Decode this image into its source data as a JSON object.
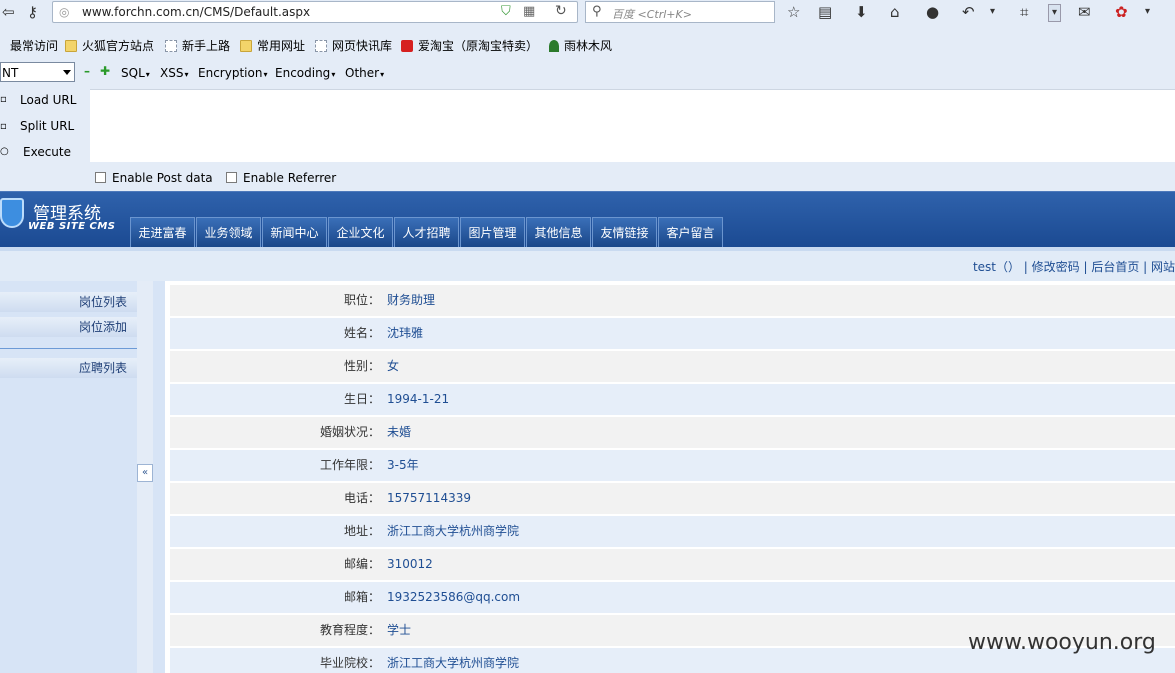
{
  "browser": {
    "url": "www.forchn.com.cn/CMS/Default.aspx",
    "search_placeholder": "百度 <Ctrl+K>"
  },
  "bookmarks": [
    "最常访问",
    "火狐官方站点",
    "新手上路",
    "常用网址",
    "网页快讯库",
    "爱淘宝（原淘宝特卖）",
    "雨林木风"
  ],
  "hackbar": {
    "select_value": "NT",
    "menus": [
      "SQL",
      "XSS",
      "Encryption",
      "Encoding",
      "Other"
    ],
    "side_actions": [
      "Load URL",
      "Split URL",
      "Execute"
    ],
    "checkboxes": [
      "Enable Post data",
      "Enable Referrer"
    ]
  },
  "cms": {
    "logo_title": "管理系统",
    "logo_subtitle": "WEB SITE CMS",
    "tabs": [
      "走进富春",
      "业务领域",
      "新闻中心",
      "企业文化",
      "人才招聘",
      "图片管理",
      "其他信息",
      "友情链接",
      "客户留言"
    ],
    "top_links": "test（） | 修改密码 | 后台首页 | 网站",
    "sidebar": [
      "岗位列表",
      "岗位添加",
      "应聘列表"
    ],
    "collapse_label": "«",
    "fields": [
      {
        "label": "职位：",
        "value": "财务助理"
      },
      {
        "label": "姓名：",
        "value": "沈玮雅"
      },
      {
        "label": "性别：",
        "value": "女"
      },
      {
        "label": "生日：",
        "value": "1994-1-21"
      },
      {
        "label": "婚姻状况：",
        "value": "未婚"
      },
      {
        "label": "工作年限：",
        "value": "3-5年"
      },
      {
        "label": "电话：",
        "value": "15757114339"
      },
      {
        "label": "地址：",
        "value": "浙江工商大学杭州商学院"
      },
      {
        "label": "邮编：",
        "value": "310012"
      },
      {
        "label": "邮箱：",
        "value": "1932523586@qq.com"
      },
      {
        "label": "教育程度：",
        "value": "学士"
      },
      {
        "label": "毕业院校：",
        "value": "浙江工商大学杭州商学院"
      }
    ]
  },
  "watermark": "www.wooyun.org"
}
